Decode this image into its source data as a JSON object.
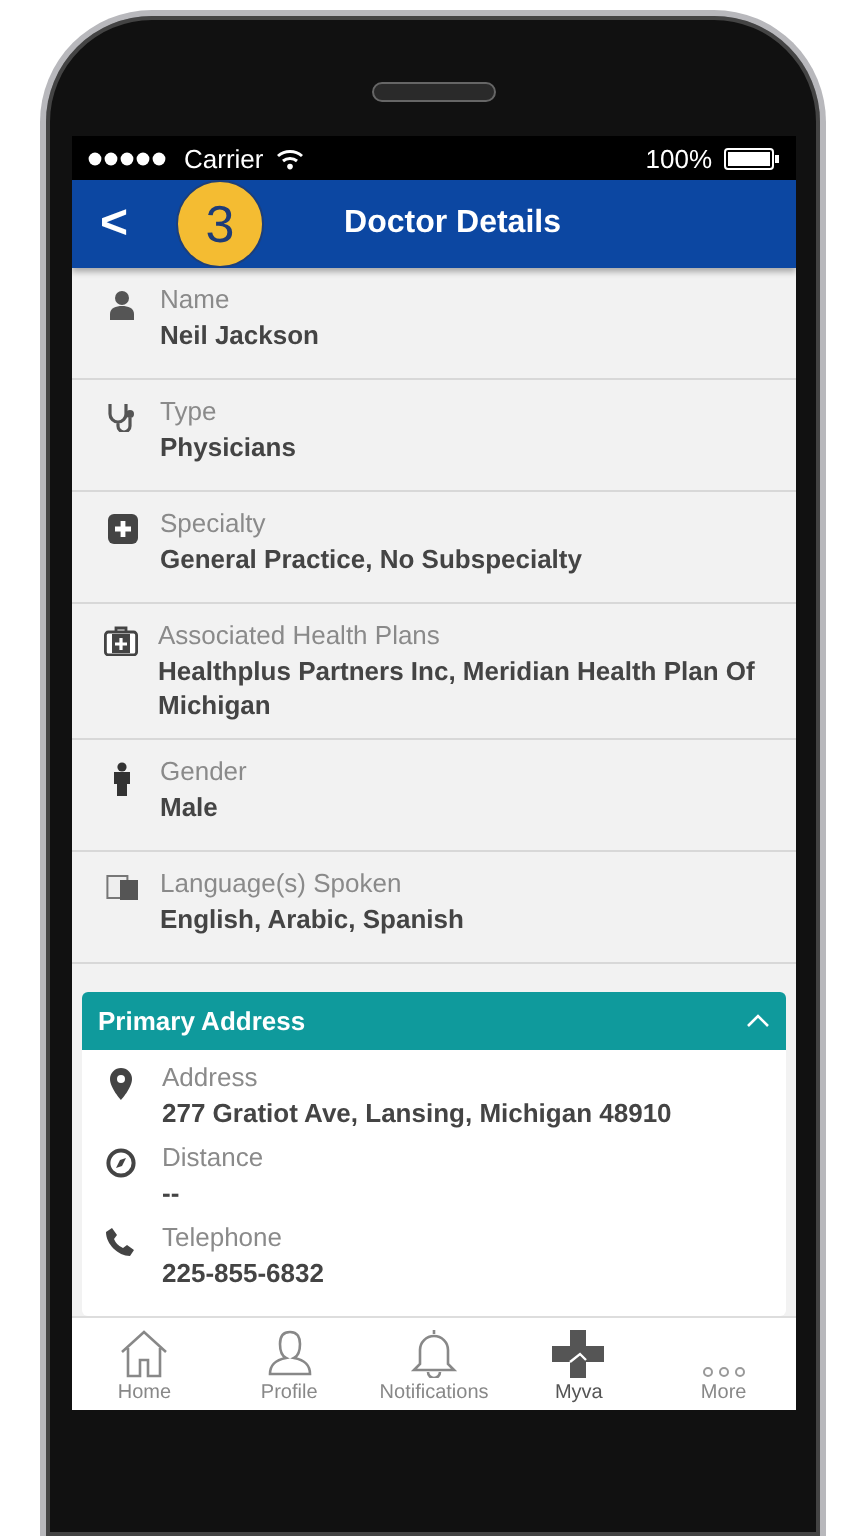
{
  "status_bar": {
    "carrier": "Carrier",
    "battery": "100%"
  },
  "header": {
    "back": "<",
    "title": "Doctor Details"
  },
  "step_badge": "3",
  "details": [
    {
      "label": "Name",
      "value": "Neil Jackson"
    },
    {
      "label": "Type",
      "value": "Physicians"
    },
    {
      "label": "Specialty",
      "value": "General Practice, No Subspecialty"
    },
    {
      "label": "Associated Health Plans",
      "value": "Healthplus Partners Inc, Meridian Health Plan Of Michigan"
    },
    {
      "label": "Gender",
      "value": "Male"
    },
    {
      "label": "Language(s) Spoken",
      "value": "English, Arabic, Spanish"
    }
  ],
  "primary_address": {
    "title": "Primary Address",
    "expanded": true,
    "items": [
      {
        "label": "Address",
        "value": "277 Gratiot Ave, Lansing, Michigan 48910"
      },
      {
        "label": "Distance",
        "value": "--"
      },
      {
        "label": "Telephone",
        "value": "225-855-6832"
      }
    ]
  },
  "tab_bar": [
    {
      "label": "Home",
      "selected": false
    },
    {
      "label": "Profile",
      "selected": false
    },
    {
      "label": "Notifications",
      "selected": false
    },
    {
      "label": "Myva",
      "selected": true
    },
    {
      "label": "More",
      "selected": false
    }
  ]
}
